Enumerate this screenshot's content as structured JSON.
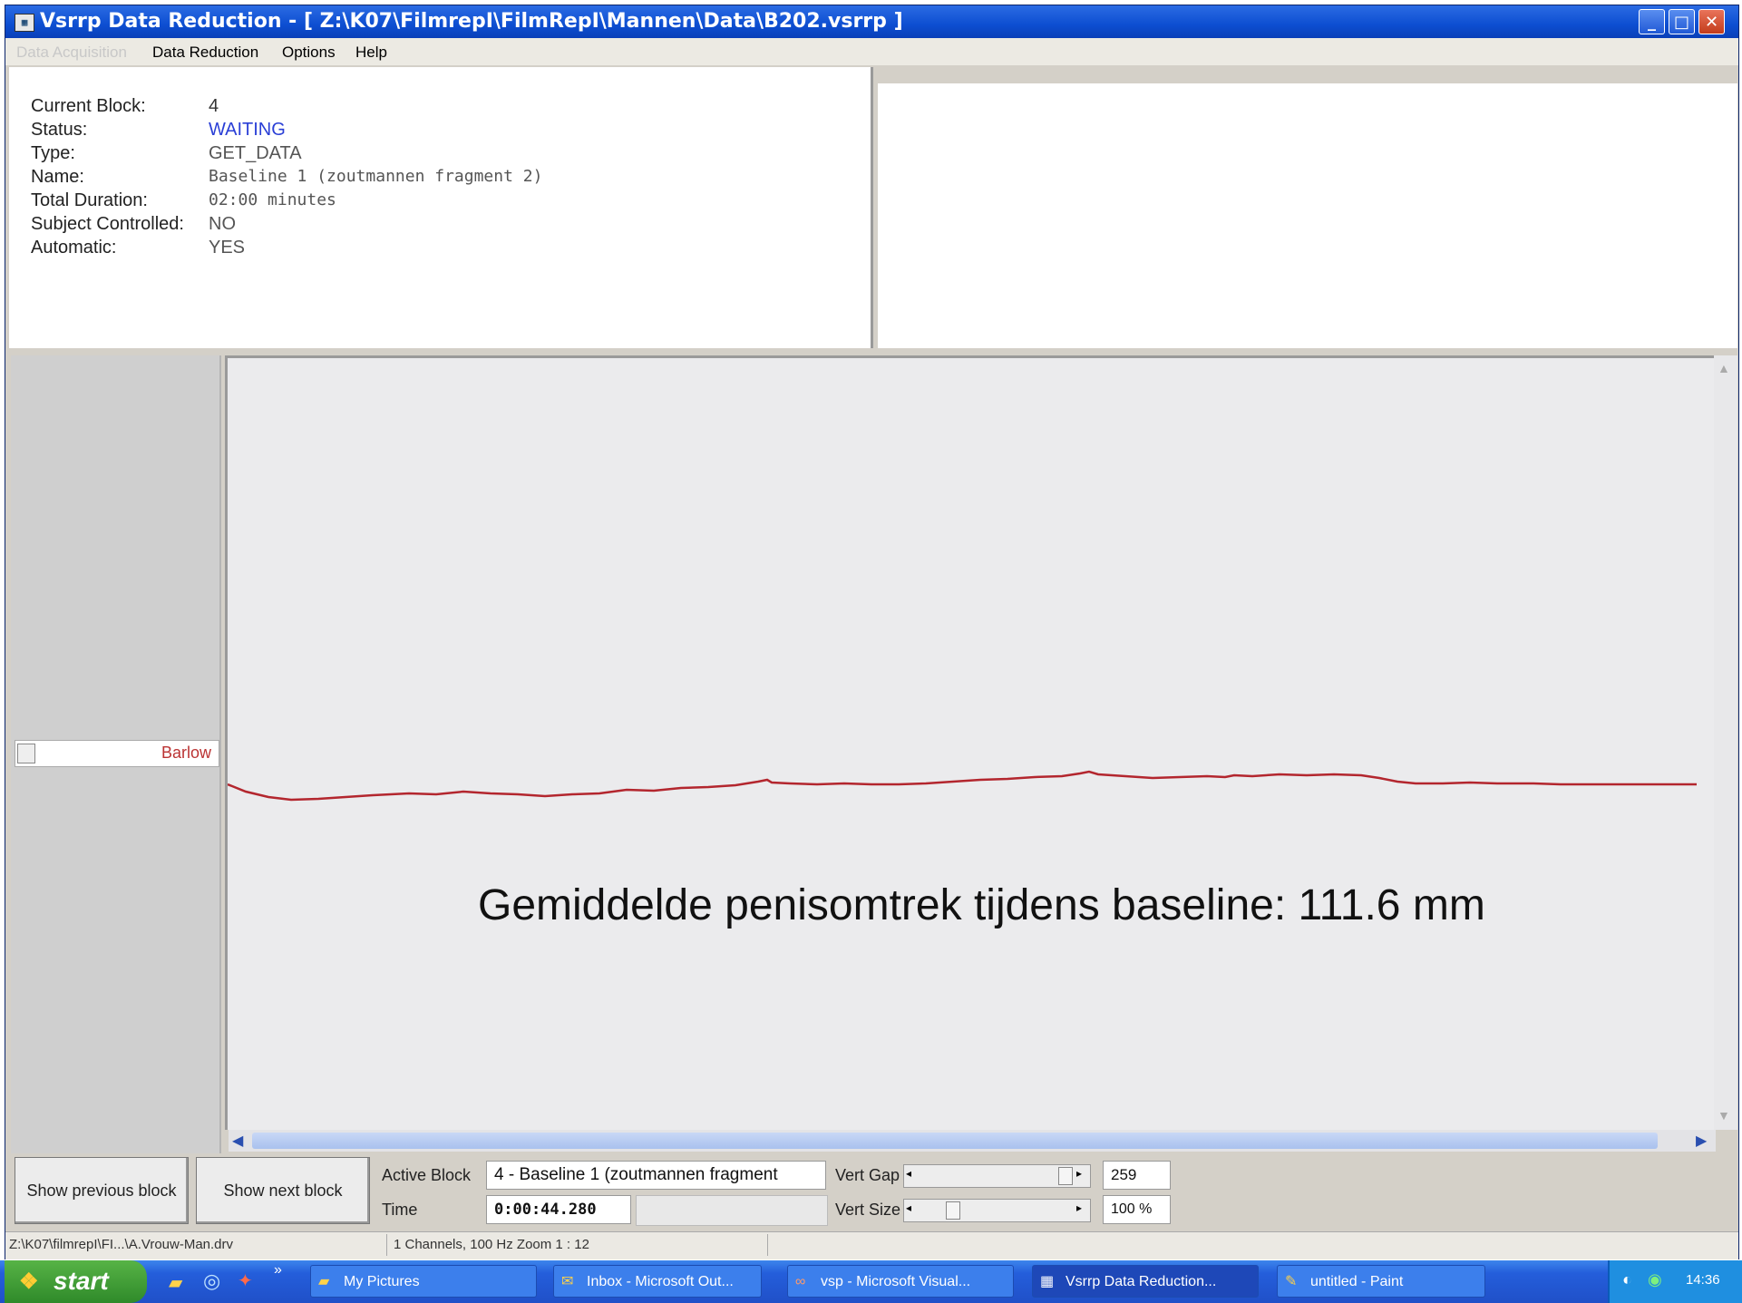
{
  "window": {
    "title": "Vsrrp Data Reduction - [ Z:\\K07\\FilmrepI\\FilmRepI\\Mannen\\Data\\B202.vsrrp ]",
    "minimize_glyph": "_",
    "maximize_glyph": "□",
    "close_glyph": "✕"
  },
  "menu": [
    "Data Acquisition",
    "Data Reduction",
    "Options",
    "Help"
  ],
  "block_info": {
    "current_block_label": "Current Block:",
    "current_block": "4",
    "status_label": "Status:",
    "status": "WAITING",
    "type_label": "Type:",
    "type": "GET_DATA",
    "name_label": "Name:",
    "name": "Baseline 1 (zoutmannen fragment 2)",
    "duration_label": "Total Duration:",
    "duration": "02:00 minutes",
    "subject_label": "Subject Controlled:",
    "subject": "NO",
    "automatic_label": "Automatic:",
    "automatic": "YES",
    "status_color": "#2a3fd6"
  },
  "channel": {
    "label": "Barlow",
    "trace_color": "#b3262e"
  },
  "annotation": "Gemiddelde penisomtrek tijdens baseline: 111.6 mm",
  "controls": {
    "prev_block": "Show previous block",
    "next_block": "Show next block",
    "active_block_label": "Active Block",
    "active_block_value": "4 - Baseline 1 (zoutmannen fragment",
    "time_label": "Time",
    "time_value": "0:00:44.280",
    "vert_gap_label": "Vert Gap",
    "vert_gap_value": "259",
    "vert_size_label": "Vert Size",
    "vert_size_value": "100 %"
  },
  "statusbar": {
    "path": "Z:\\K07\\filmrepI\\FI...\\A.Vrouw-Man.drv",
    "info": "1 Channels, 100 Hz  Zoom 1 : 12"
  },
  "taskbar": {
    "start": "start",
    "tasks": [
      "My Pictures",
      "Inbox - Microsoft Out...",
      "vsp - Microsoft Visual...",
      "Vsrrp Data Reduction...",
      "untitled - Paint"
    ],
    "clock": "14:36"
  }
}
